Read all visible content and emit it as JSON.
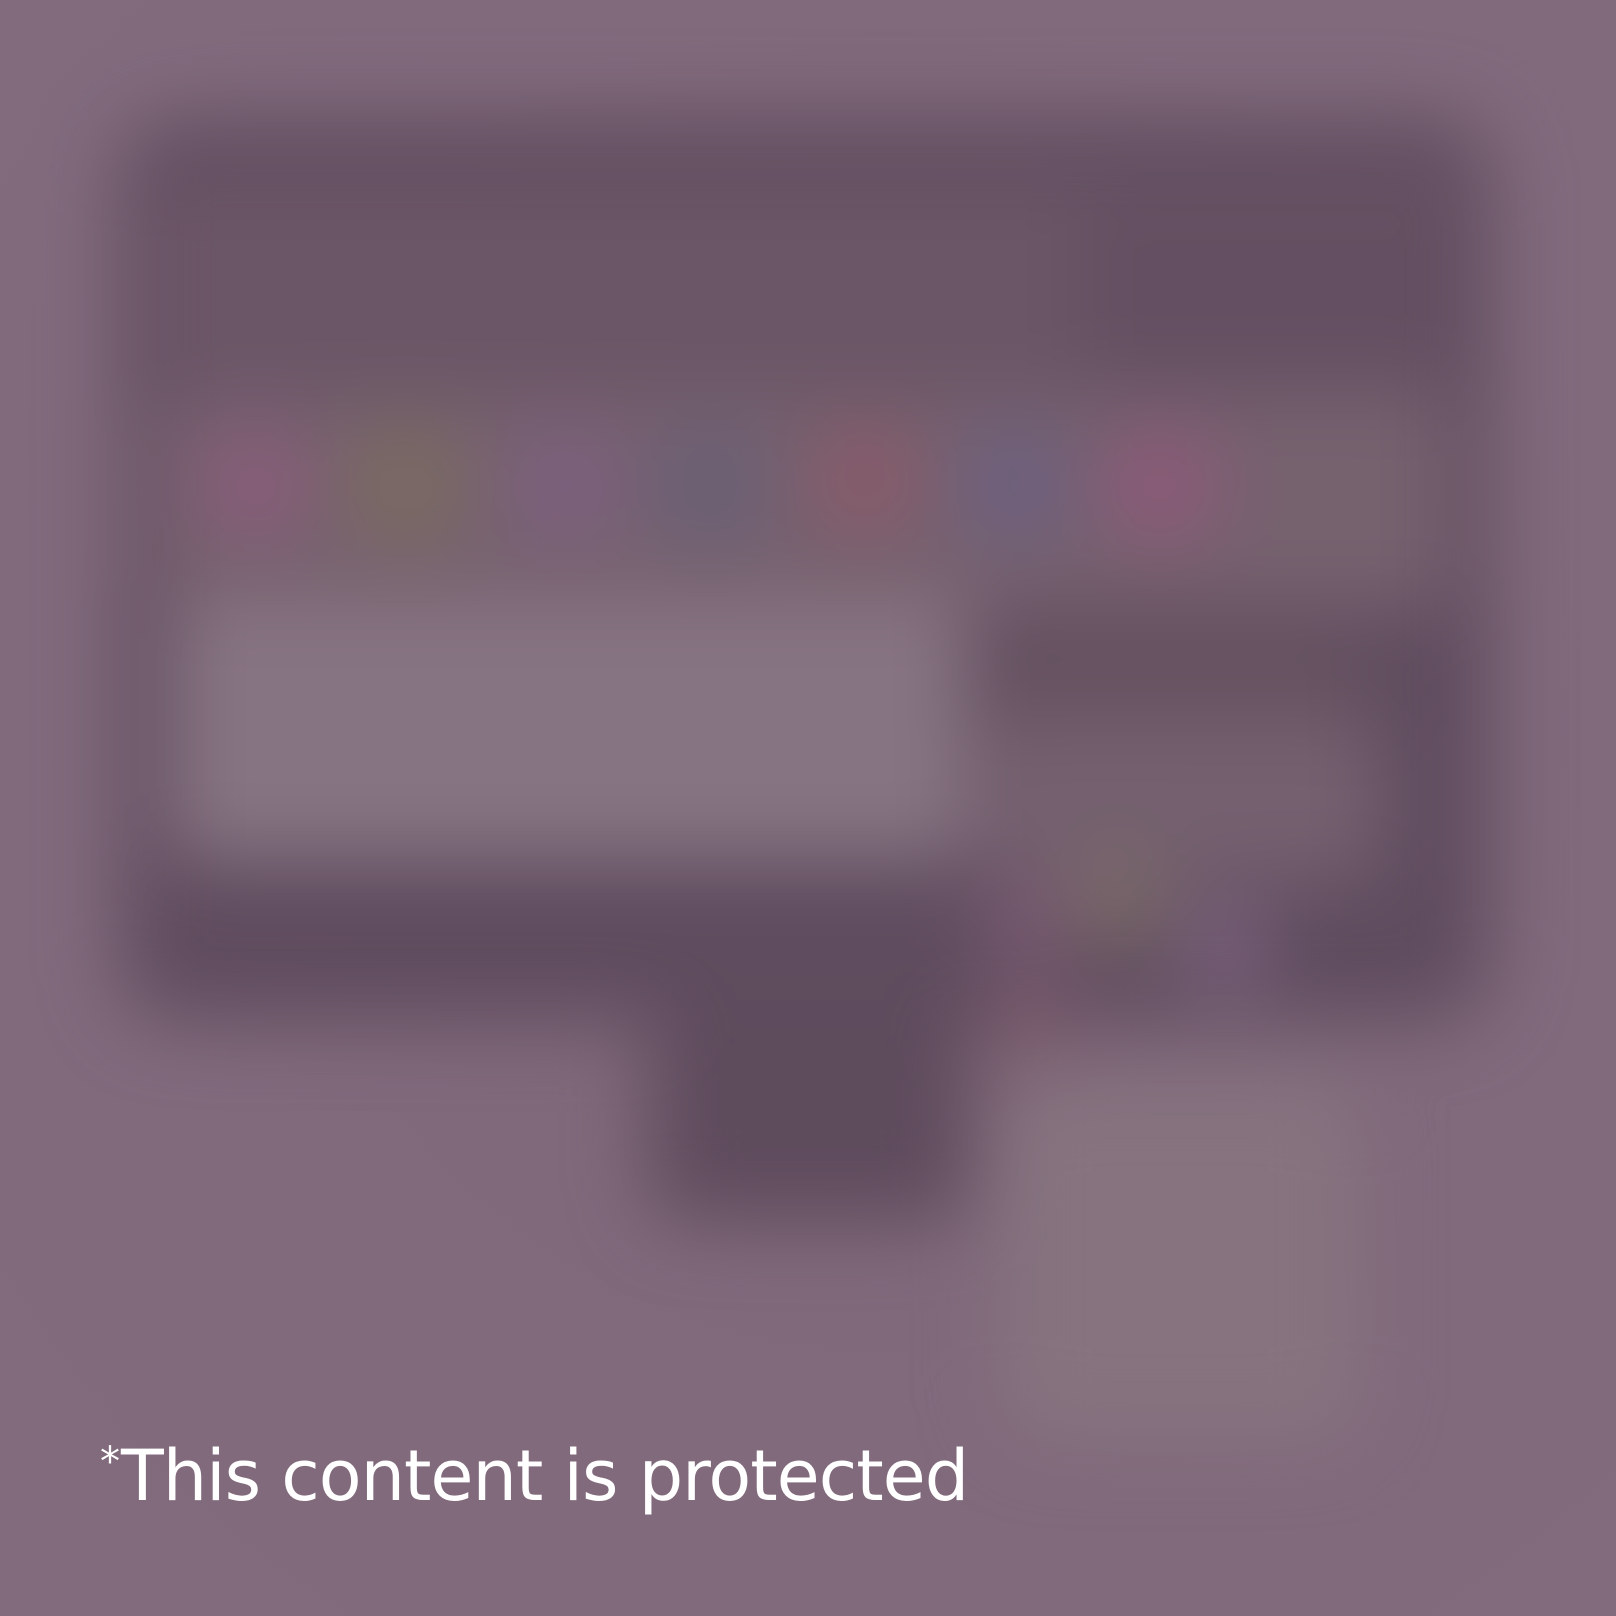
{
  "notice": {
    "asterisk": "*",
    "text": "This content is protected"
  },
  "overlay": {
    "state": "blurred",
    "background_color": "#806a7c",
    "text_color": "#ffffff"
  },
  "blurred_app_tiles": [
    {
      "name": "tile-1",
      "color": "#8a5c7a"
    },
    {
      "name": "tile-2",
      "color": "#7a6a62"
    },
    {
      "name": "tile-3",
      "color": "#7e6080"
    },
    {
      "name": "tile-4",
      "color": "#6a6075"
    },
    {
      "name": "tile-5",
      "color": "#8a5a6a"
    },
    {
      "name": "tile-6",
      "color": "#6c6080"
    },
    {
      "name": "tile-7",
      "color": "#8c5a78"
    }
  ]
}
